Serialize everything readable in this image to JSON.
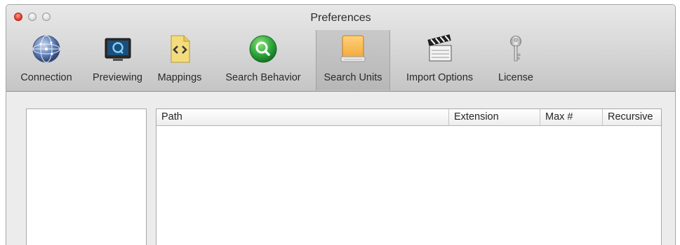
{
  "window": {
    "title": "Preferences"
  },
  "toolbar": {
    "items": [
      {
        "label": "Connection",
        "icon": "globe-icon"
      },
      {
        "label": "Previewing",
        "icon": "monitor-icon"
      },
      {
        "label": "Mappings",
        "icon": "code-file-icon"
      },
      {
        "label": "Search Behavior",
        "icon": "search-icon"
      },
      {
        "label": "Search Units",
        "icon": "drive-icon",
        "selected": true
      },
      {
        "label": "Import Options",
        "icon": "clapperboard-icon"
      },
      {
        "label": "License",
        "icon": "key-icon"
      }
    ]
  },
  "table": {
    "columns": [
      "Path",
      "Extension",
      "Max #",
      "Recursive"
    ],
    "rows": []
  },
  "colors": {
    "close_button": "#e6432f",
    "search_icon": "#2fa83c",
    "drive_icon": "#f2a93a"
  }
}
